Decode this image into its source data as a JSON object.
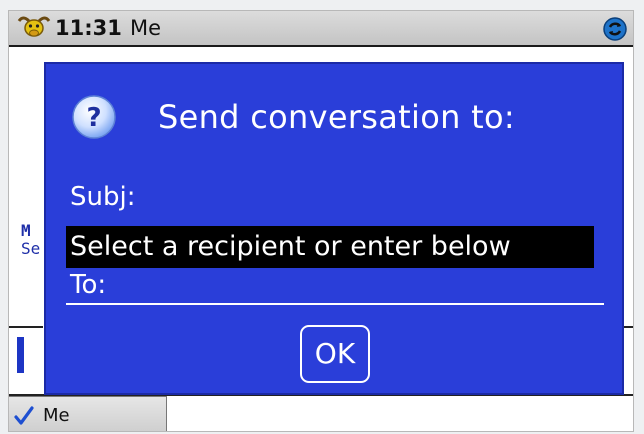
{
  "status_bar": {
    "time": "11:31",
    "user": "Me",
    "app_icon": "bull-mascot-icon",
    "sync_icon": "sync-icon"
  },
  "background": {
    "fragment_1": "M",
    "fragment_2": "Se"
  },
  "bottom_tab": {
    "label": "Me",
    "icon": "checkmark-icon"
  },
  "dialog": {
    "title": "Send conversation to:",
    "icon": "question-help-icon",
    "subj_label": "Subj:",
    "recipient_prompt": "Select a recipient or enter below",
    "to_label": "To:",
    "ok_label": "OK"
  },
  "colors": {
    "dialog_background": "#2a3ed9",
    "highlight": "#000000",
    "text_on_dialog": "#ffffff"
  }
}
